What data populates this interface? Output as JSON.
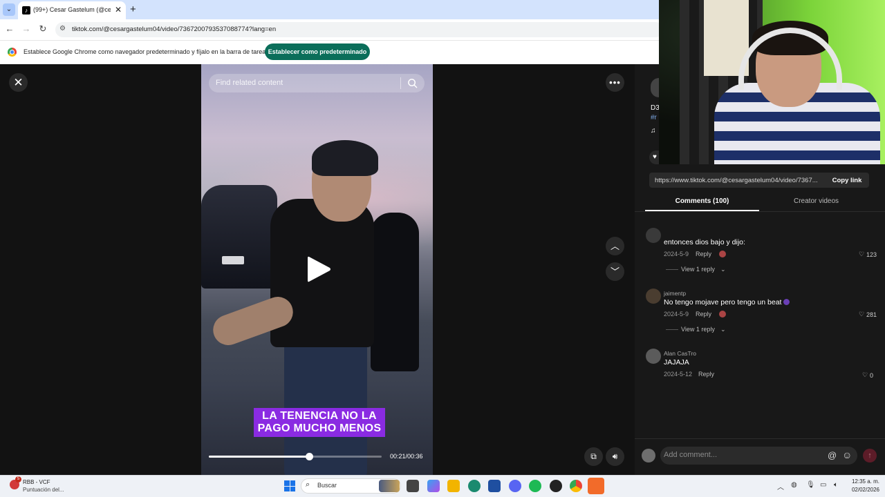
{
  "browser": {
    "tab_title": "(99+) Cesar Gastelum (@cesarg",
    "url": "tiktok.com/@cesargastelum04/video/7367200793537088774?lang=en",
    "infobar_text": "Establece Google Chrome como navegador predeterminado y fíjalo en la barra de tareas",
    "infobar_button": "Establecer como predeterminado"
  },
  "player": {
    "search_placeholder": "Find related content",
    "caption_line1": "LA TENENCIA NO LA",
    "caption_line2": "PAGO MUCHO MENOS",
    "time": "00:21/00:36",
    "progress": 0.58
  },
  "panel": {
    "desc_partial_1": "D3",
    "desc_partial_2": "#r",
    "desc_partial_3": "♫",
    "share_url": "https://www.tiktok.com/@cesargastelum04/video/7367...",
    "copy_link": "Copy link",
    "tab_comments": "Comments (100)",
    "tab_creator": "Creator videos"
  },
  "comments": [
    {
      "user": "",
      "text": "entonces dios bajo y dijo:",
      "date": "2024-5-9",
      "reply": "Reply",
      "likes": "123",
      "view_replies": "View 1 reply"
    },
    {
      "user": "jaimentp",
      "text": "No tengo mojave pero tengo un beat",
      "date": "2024-5-9",
      "reply": "Reply",
      "likes": "281",
      "view_replies": "View 1 reply"
    },
    {
      "user": "Alan CasTro",
      "text": "JAJAJA",
      "date": "2024-5-12",
      "reply": "Reply",
      "likes": "0"
    }
  ],
  "comment_bar": {
    "placeholder": "Add comment..."
  },
  "taskbar": {
    "weather_title": "RBB - VCF",
    "weather_sub": "Puntuación del...",
    "weather_badge": "5",
    "search": "Buscar",
    "time": "12:35 a. m.",
    "date": "02/02/2026"
  },
  "colors": {
    "accent_teal": "#0b6e5a",
    "caption_purple": "#8a2be2",
    "panel_bg": "#181818"
  }
}
